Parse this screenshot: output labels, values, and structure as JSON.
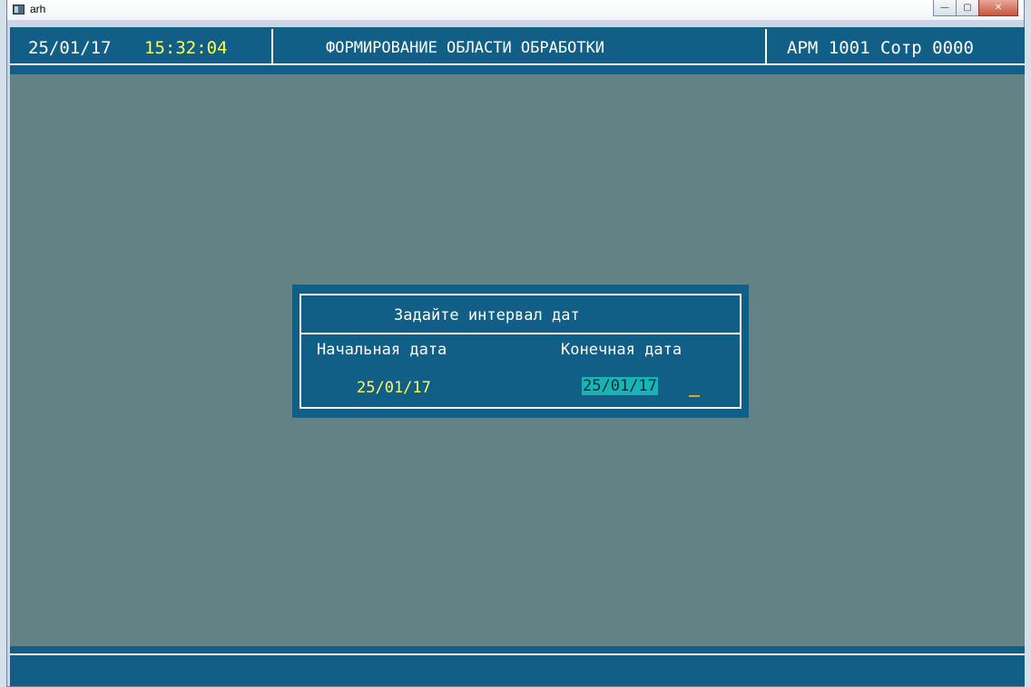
{
  "window": {
    "title": "arh",
    "buttons": {
      "minimize": "—",
      "maximize": "▢",
      "close": "✕"
    }
  },
  "header": {
    "date": "25/01/17",
    "time": "15:32:04",
    "title": "ФОРМИРОВАНИЕ ОБЛАСТИ ОБРАБОТКИ",
    "workstation": "АРМ 1001 Сотр 0000"
  },
  "dialog": {
    "title": "Задайте интервал дат",
    "start_label": "Начальная дата",
    "end_label": "Конечная дата",
    "start_value": "25/01/17",
    "end_value": "25/01/17"
  },
  "colors": {
    "console_bg": "#628286",
    "bar_bg": "#115f86",
    "time_text": "#ffff55",
    "active_field_bg": "#19b3b3",
    "cursor": "#e8a020"
  }
}
